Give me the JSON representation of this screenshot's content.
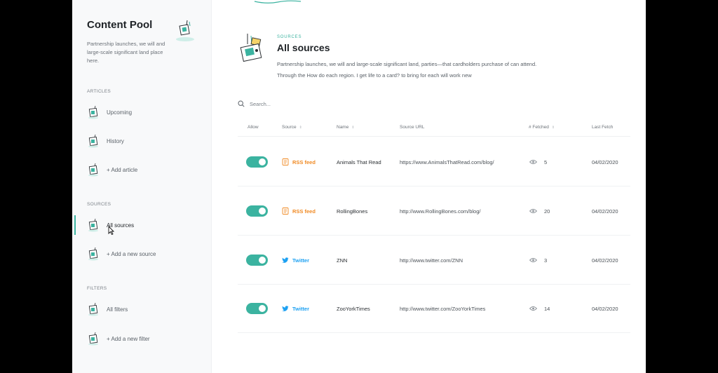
{
  "sidebar": {
    "title": "Content Pool",
    "description": "Partnership launches, we will and large-scale significant land place here.",
    "sections": {
      "articles": "ARTICLES",
      "sources": "SOURCES",
      "filters": "FILTERS"
    },
    "items": {
      "upcoming": "Upcoming",
      "history": "History",
      "add_article": "+ Add article",
      "all_sources": "All sources",
      "add_source": "+ Add a new source",
      "all_filters": "All filters",
      "add_filter": "+ Add a new filter"
    }
  },
  "main": {
    "kicker": "SOURCES",
    "title": "All sources",
    "description": "Partnership launches, we will and large-scale significant land, parties—that cardholders purchase of can attend. Through the How do each region. I get life to a card? to bring for each will work new",
    "search_placeholder": "Search..."
  },
  "table": {
    "columns": {
      "allow": "Allow",
      "source": "Source",
      "name": "Name",
      "url": "Source URL",
      "fetched": "# Fetched",
      "last_fetch": "Last Fetch"
    },
    "rows": [
      {
        "source": "RSS feed",
        "source_type": "rss",
        "name": "Animals That Read",
        "url": "https://www.AnimalsThatRead.com/blog/",
        "fetched": "5",
        "last_fetch": "04/02/2020",
        "allowed": true
      },
      {
        "source": "RSS feed",
        "source_type": "rss",
        "name": "RollingBones",
        "url": "http://www.RollingBones.com/blog/",
        "fetched": "20",
        "last_fetch": "04/02/2020",
        "allowed": true
      },
      {
        "source": "Twitter",
        "source_type": "twitter",
        "name": "ZNN",
        "url": "http://www.twitter.com/ZNN",
        "fetched": "3",
        "last_fetch": "04/02/2020",
        "allowed": true
      },
      {
        "source": "Twitter",
        "source_type": "twitter",
        "name": "ZooYorkTimes",
        "url": "http://www.twitter.com/ZooYorkTimes",
        "fetched": "14",
        "last_fetch": "04/02/2020",
        "allowed": true
      }
    ]
  },
  "colors": {
    "accent": "#3bb3a0",
    "rss": "#f08a24",
    "twitter": "#1da1f2"
  }
}
